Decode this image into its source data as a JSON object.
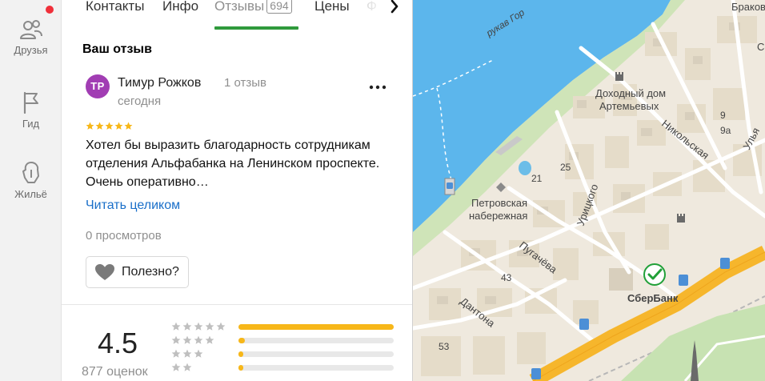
{
  "rail": {
    "friends_label": "Друзья",
    "guide_label": "Гид",
    "housing_label": "Жильё"
  },
  "tabs": {
    "contacts": "Контакты",
    "info": "Инфо",
    "reviews": "Отзывы",
    "reviews_count": "694",
    "prices": "Цены",
    "cut_off": "Ф"
  },
  "review_section": {
    "title": "Ваш отзыв",
    "author_initials": "ТР",
    "author_name": "Тимур Рожков",
    "author_reviews": "1 отзыв",
    "date": "сегодня",
    "rating": 5,
    "text": "Хотел бы выразить благодарность сотрудникам отделения Альфабанка на Ленинском проспекте. Очень оперативно…",
    "read_more": "Читать целиком",
    "views": "0 просмотров",
    "useful_label": "Полезно?"
  },
  "summary": {
    "rating": "4.5",
    "ratings_count": "877 оценок",
    "distribution": [
      {
        "stars": 5,
        "share": 1.0
      },
      {
        "stars": 4,
        "share": 0.04
      },
      {
        "stars": 3,
        "share": 0.03
      },
      {
        "stars": 2,
        "share": 0.02
      }
    ]
  },
  "map": {
    "labels": {
      "river_branch": "рукав Гор",
      "brakov": "Браков",
      "tenement_line1": "Доходный дом",
      "tenement_line2": "Артемьевых",
      "nikolskaya": "Никольская",
      "ulya": "Улья",
      "petrovskaya_line1": "Петровская",
      "petrovskaya_line2": "набережная",
      "uritskogo": "Урицкого",
      "pugacheva": "Пугачёва",
      "dantona": "Дантона",
      "sberbank": "СберБанк",
      "se": "Се",
      "n25": "25",
      "n21": "21",
      "n9": "9",
      "n9a": "9а",
      "n43": "43",
      "n53": "53"
    }
  },
  "colors": {
    "accent_green": "#2f9a3c",
    "avatar": "#a13db3",
    "link": "#1a6fc9",
    "star": "#f7b719",
    "river": "#5cb6ec",
    "road_major": "#f6b62c",
    "notification": "#f0303a"
  }
}
